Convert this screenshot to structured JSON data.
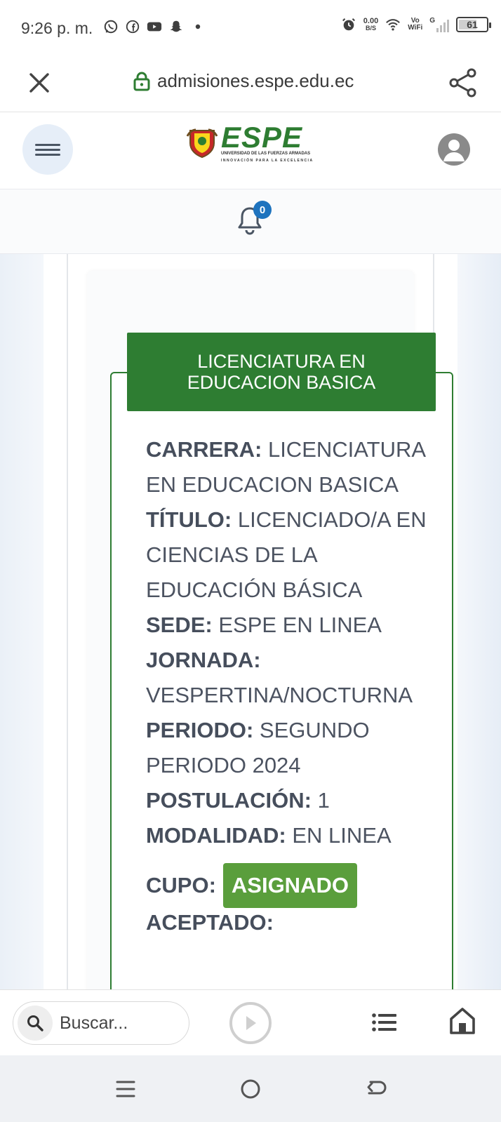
{
  "status_bar": {
    "time": "9:26 p. m.",
    "net_speed_value": "0.00",
    "net_speed_unit": "B/S",
    "wifi_label_top": "Vo",
    "wifi_label_bottom": "WiFi",
    "signal_label": "G",
    "battery_level": "61",
    "icons": [
      "whatsapp-icon",
      "facebook-icon",
      "youtube-icon",
      "snapchat-icon",
      "dot-icon",
      "alarm-icon",
      "wifi-icon",
      "signal-icon",
      "battery-icon"
    ]
  },
  "browser": {
    "url": "admisiones.espe.edu.ec",
    "secure_icon": "lock-icon"
  },
  "site": {
    "logo_text": "ESPE",
    "logo_subtitle": "UNIVERSIDAD DE LAS FUERZAS ARMADAS",
    "logo_tagline": "INNOVACIÓN PARA LA EXCELENCIA",
    "notification_count": "0",
    "brand_color": "#2e7d32"
  },
  "career": {
    "header": "LICENCIATURA EN EDUCACION BASICA",
    "fields": [
      {
        "label": "CARRERA:",
        "value": "LICENCIATURA EN EDUCACION BASICA"
      },
      {
        "label": "TÍTULO:",
        "value": "LICENCIADO/A EN CIENCIAS DE LA EDUCACIÓN BÁSICA"
      },
      {
        "label": "SEDE:",
        "value": "ESPE EN LINEA"
      },
      {
        "label": "JORNADA:",
        "value": "VESPERTINA/NOCTURNA"
      },
      {
        "label": "PERIODO:",
        "value": "SEGUNDO PERIODO 2024"
      },
      {
        "label": "POSTULACIÓN:",
        "value": "1"
      },
      {
        "label": "MODALIDAD:",
        "value": "EN LINEA"
      }
    ],
    "cupo_label": "CUPO:",
    "cupo_value": "ASIGNADO",
    "cupo_color": "#5a9e3c",
    "aceptado_label": "ACEPTADO:"
  },
  "toolbar": {
    "search_placeholder": "Buscar..."
  }
}
